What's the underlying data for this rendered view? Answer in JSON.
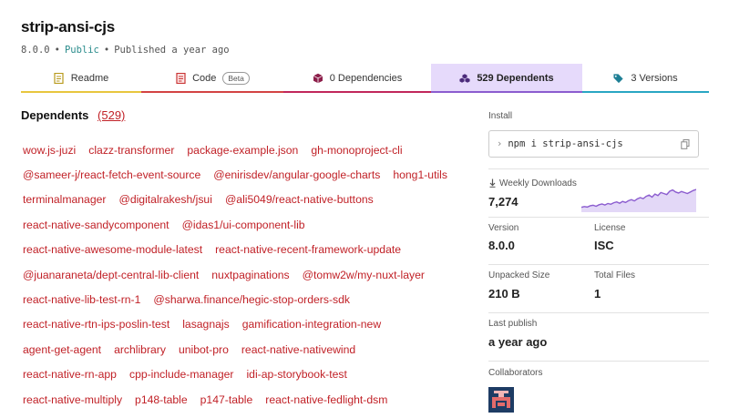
{
  "package": {
    "name": "strip-ansi-cjs",
    "version": "8.0.0",
    "visibility": "Public",
    "published": "Published a year ago"
  },
  "tabs": [
    {
      "label": "Readme",
      "icon": "readme-icon",
      "color": "#e8c63e"
    },
    {
      "label": "Code",
      "badge": "Beta",
      "icon": "code-icon",
      "color": "#d34343"
    },
    {
      "label": "0 Dependencies",
      "icon": "cube-icon",
      "color": "#c1275b"
    },
    {
      "label": "529 Dependents",
      "icon": "cubes-icon",
      "color": "#8b5ccf",
      "active": true
    },
    {
      "label": "3 Versions",
      "icon": "tag-icon",
      "color": "#29a6c3"
    }
  ],
  "dependents": {
    "heading": "Dependents",
    "count": "(529)",
    "rows": [
      [
        "wow.js-juzi",
        "clazz-transformer",
        "package-example.json",
        "gh-monoproject-cli"
      ],
      [
        "@sameer-j/react-fetch-event-source",
        "@enirisdev/angular-google-charts",
        "hong1-utils"
      ],
      [
        "terminalmanager",
        "@digitalrakesh/jsui",
        "@ali5049/react-native-buttons"
      ],
      [
        "react-native-sandycomponent",
        "@idas1/ui-component-lib"
      ],
      [
        "react-native-awesome-module-latest",
        "react-native-recent-framework-update"
      ],
      [
        "@juanaraneta/dept-central-lib-client",
        "nuxtpaginations",
        "@tomw2w/my-nuxt-layer"
      ],
      [
        "react-native-lib-test-rn-1",
        "@sharwa.finance/hegic-stop-orders-sdk"
      ],
      [
        "react-native-rtn-ips-poslin-test",
        "lasagnajs",
        "gamification-integration-new"
      ],
      [
        "agent-get-agent",
        "archlibrary",
        "unibot-pro",
        "react-native-nativewind"
      ],
      [
        "react-native-rn-app",
        "cpp-include-manager",
        "idi-ap-storybook-test"
      ],
      [
        "react-native-multiply",
        "p148-table",
        "p147-table",
        "react-native-fedlight-dsm"
      ]
    ]
  },
  "sidebar": {
    "install_label": "Install",
    "install_command": "npm i strip-ansi-cjs",
    "weekly_downloads_label": "Weekly Downloads",
    "weekly_downloads": "7,274",
    "weekly_downloads_trend": [
      0.12,
      0.15,
      0.13,
      0.18,
      0.2,
      0.16,
      0.22,
      0.25,
      0.21,
      0.27,
      0.24,
      0.3,
      0.33,
      0.28,
      0.35,
      0.31,
      0.38,
      0.42,
      0.37,
      0.45,
      0.5,
      0.46,
      0.55,
      0.6,
      0.52,
      0.64,
      0.58,
      0.7,
      0.66,
      0.62,
      0.75,
      0.8,
      0.72,
      0.68,
      0.74,
      0.7,
      0.66,
      0.72,
      0.78,
      0.82
    ],
    "version_label": "Version",
    "version": "8.0.0",
    "license_label": "License",
    "license": "ISC",
    "unpacked_size_label": "Unpacked Size",
    "unpacked_size": "210 B",
    "total_files_label": "Total Files",
    "total_files": "1",
    "last_publish_label": "Last publish",
    "last_publish": "a year ago",
    "collaborators_label": "Collaborators"
  },
  "colors": {
    "link": "#c12127",
    "active_tab_bg": "#e6dafb",
    "sparkline": "#8b5ccf"
  }
}
